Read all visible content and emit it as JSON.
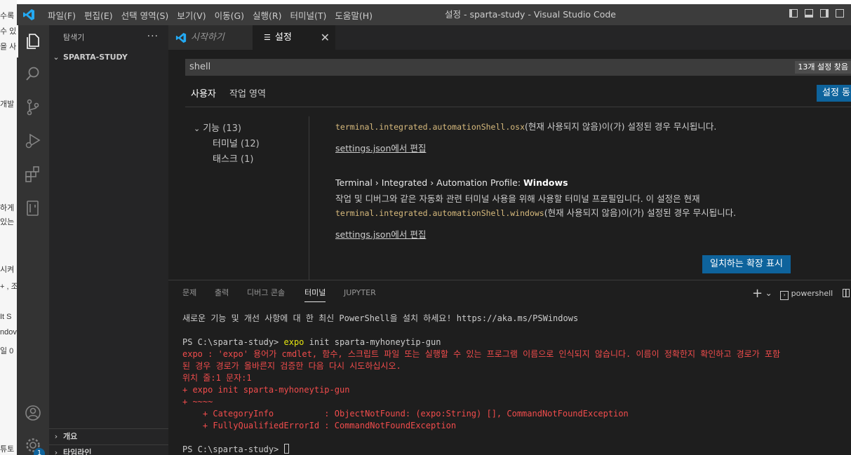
{
  "background_app": {
    "fragments": [
      "수록",
      "수 있",
      "을 사",
      "개발",
      "하게",
      "있는",
      "시켜",
      "+ , 조",
      "It S",
      "ndov",
      "일 0",
      "튜토"
    ]
  },
  "titlebar": {
    "menu": [
      "파일(F)",
      "편집(E)",
      "선택 영역(S)",
      "보기(V)",
      "이동(G)",
      "실행(R)",
      "터미널(T)",
      "도움말(H)"
    ],
    "title": "설정 - sparta-study - Visual Studio Code"
  },
  "activity": {
    "items": [
      "files-icon",
      "search-icon",
      "source-control-icon",
      "run-debug-icon",
      "extensions-icon",
      "remote-icon"
    ],
    "bottom": [
      "account-icon",
      "manage-gear-icon"
    ],
    "badge_count": "1"
  },
  "sidebar": {
    "title": "탐색기",
    "more": "···",
    "folder": "SPARTA-STUDY",
    "outline": "개요",
    "timeline": "타임라인"
  },
  "tabs": {
    "welcome": "시작하기",
    "settings": "설정",
    "close": "✕"
  },
  "settings": {
    "search_value": "shell",
    "result_count": "13개 설정 찾음",
    "scope_user": "사용자",
    "scope_workspace": "작업 영역",
    "sync_button": "설정 동기화",
    "toc": {
      "features": "기능",
      "features_count": "(13)",
      "terminal": "터미널",
      "terminal_count": "(12)",
      "tasks": "태스크",
      "tasks_count": "(1)"
    },
    "osx_code": "terminal.integrated.automationShell.osx",
    "osx_suffix": "(현재 사용되지 않음)이(가) 설정된 경우 무시됩니다.",
    "edit_link_1": "settings.json에서 편집",
    "win_title_prefix": "Terminal › Integrated › Automation Profile: ",
    "win_title_name": "Windows",
    "win_desc": "작업 및 디버그와 같은 자동화 관련 터미널 사용을 위해 사용할 터미널 프로필입니다. 이 설정은 현재",
    "win_code": "terminal.integrated.automationShell.windows",
    "win_suffix": "(현재 사용되지 않음)이(가) 설정된 경우 무시됩니다.",
    "edit_link_2": "settings.json에서 편집",
    "ext_button": "일치하는 확장 표시"
  },
  "panel": {
    "tabs": [
      "문제",
      "출력",
      "디버그 콘솔",
      "터미널",
      "JUPYTER"
    ],
    "active_tab": "터미널",
    "add": "+",
    "dropdown": "⌄",
    "shell_name": "powershell"
  },
  "terminal": {
    "line1": "새로운 기능 및 개선 사항에 대 한 최신 PowerShell을 설치 하세요! https://aka.ms/PSWindows",
    "prompt1": "PS C:\\sparta-study> ",
    "cmd_word": "expo",
    "cmd_rest": " init sparta-myhoneytip-gun",
    "err1": "expo : 'expo' 용어가 cmdlet, 함수, 스크립트 파일 또는 실행할 수 있는 프로그램 이름으로 인식되지 않습니다. 이름이 정확한지 확인하고 경로가 포함",
    "err2": "된 경우 경로가 올바른지 검증한 다음 다시 시도하십시오.",
    "err3": "위치 줄:1 문자:1",
    "err4": "+ expo init sparta-myhoneytip-gun",
    "err5": "+ ~~~~",
    "err6": "    + CategoryInfo          : ObjectNotFound: (expo:String) [], CommandNotFoundException",
    "err7": "    + FullyQualifiedErrorId : CommandNotFoundException",
    "prompt2": "PS C:\\sparta-study> "
  },
  "colors": {
    "accent": "#0e639c",
    "error": "#f14c4c",
    "command": "#e5e510"
  }
}
